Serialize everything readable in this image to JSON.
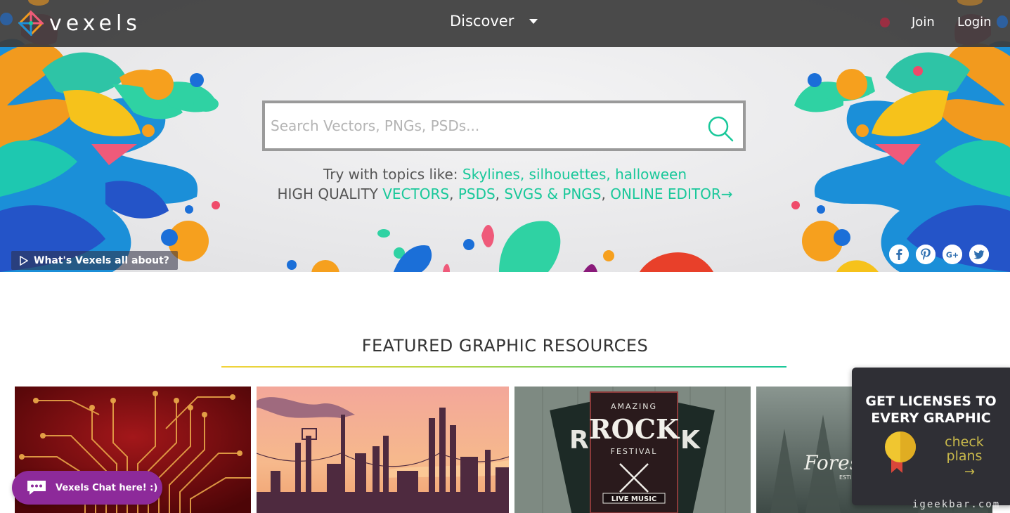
{
  "brand": {
    "name": "vexels"
  },
  "nav": {
    "discover_label": "Discover",
    "join_label": "Join",
    "login_label": "Login"
  },
  "search": {
    "placeholder": "Search Vectors, PNGs, PSDs..."
  },
  "hero": {
    "try_prefix": "Try with topics like: ",
    "topics": [
      "Skylines",
      "silhouettes",
      "halloween"
    ],
    "quality_prefix": "HIGH QUALITY ",
    "quality_links": [
      "VECTORS",
      "PSDS",
      "SVGS & PNGS",
      "ONLINE EDITOR"
    ],
    "quality_arrow": "→",
    "whats_label": "What's Vexels all about?"
  },
  "socials": [
    {
      "icon": "facebook-icon",
      "glyph": "f"
    },
    {
      "icon": "pinterest-icon",
      "glyph": "P"
    },
    {
      "icon": "google-plus-icon",
      "glyph": "G+"
    },
    {
      "icon": "twitter-icon",
      "glyph": "t"
    }
  ],
  "featured": {
    "title": "FEATURED GRAPHIC RESOURCES",
    "cards": [
      {
        "name": "circuit-board-card"
      },
      {
        "name": "industrial-skyline-card"
      },
      {
        "name": "rock-festival-poster-card",
        "poster_top": "AMAZING",
        "poster_main": "ROCK",
        "poster_sub": "FESTIVAL",
        "poster_bottom": "LIVE MUSIC",
        "poster_side_left": "R",
        "poster_side_right": "K"
      },
      {
        "name": "forest-badge-card",
        "badge_text": "Forest",
        "badge_sub": "ESTI"
      }
    ]
  },
  "chat": {
    "label": "Vexels Chat here! :)"
  },
  "license": {
    "title_line1": "GET LICENSES TO",
    "title_line2": "EVERY GRAPHIC",
    "check_line1": "check",
    "check_line2": "plans",
    "arrow": "→"
  },
  "watermark": "igeekbar.com",
  "colors": {
    "accent_green": "#19c89a",
    "nav_bg": "#3c3c3c",
    "chat_purple": "#8d2a9a",
    "license_gold": "#c9b94b"
  }
}
